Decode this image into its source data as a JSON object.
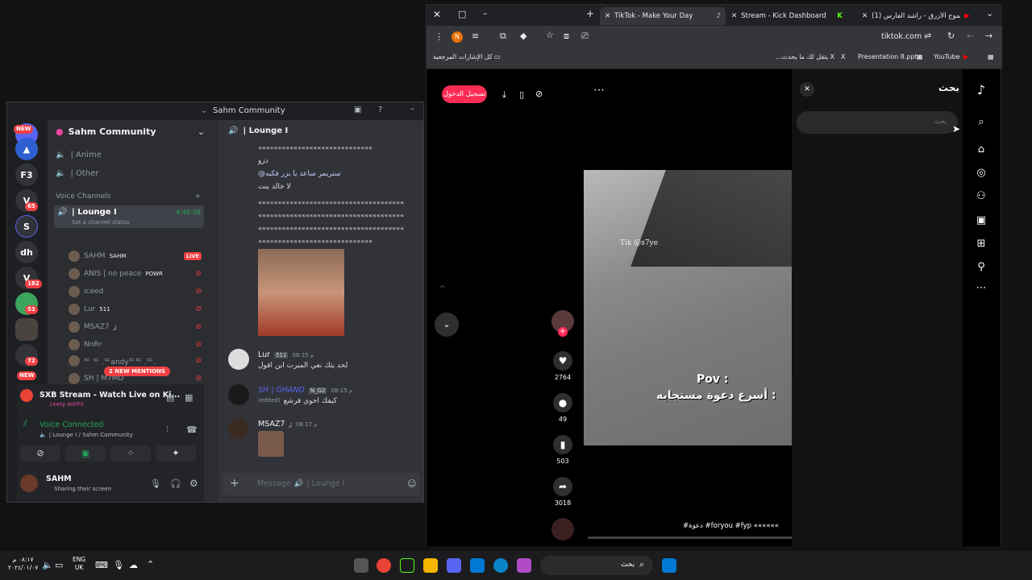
{
  "discord": {
    "window_title": "Sahm Community",
    "server_name": "Sahm Community",
    "guild_badges": [
      "NEW",
      "65",
      "182",
      "53",
      "72",
      "NEW"
    ],
    "guild_label": "dh",
    "text_channels": [
      "| Anime",
      "| Other"
    ],
    "voice_header": "Voice Channels",
    "active_voice": "| Lounge I",
    "active_timer": "4:46:08",
    "channel_status": "Set a channel status",
    "voice_users": [
      {
        "name": "SAHM",
        "tag": "SAHM",
        "badge": "LIVE"
      },
      {
        "name": "ANIS | no peace",
        "tag": "POWR"
      },
      {
        "name": "iceed",
        "tag": ""
      },
      {
        "name": "Lur",
        "tag": "511"
      },
      {
        "name": "MSAZ7",
        "tag": "ژ"
      },
      {
        "name": "NnRr",
        "tag": ""
      },
      {
        "name": "ᄃ ᄃ .ᄃandyᄃᄃ .ᄃ.",
        "tag": ""
      },
      {
        "name": "SH | M7MD",
        "tag": ""
      },
      {
        "name": "SH",
        "tag": ""
      }
    ],
    "mentions_pill": "2 NEW MENTIONS",
    "activity_title": "SXB Stream - Watch Live on Ki...",
    "activity_sub": "1440p 60FPS",
    "voice_connected": "Voice Connected",
    "voice_location": "| Lounge I / Sahm Community",
    "user_name": "SAHM",
    "user_status": "Sharing their screen",
    "chat_header": "| Lounge I",
    "chat_lines": [
      "«««««««««««««««««««««««««««««",
      "دزو",
      "@ستريمر ساعد يا بزر فكيه",
      "لا خالد بنت",
      "«««««««««««««««««««««««««««««««««««««",
      "«««««««««««««««««««««««««««««««««««««",
      "«««««««««««««««««««««««««««««««««««««",
      "«««««««««««««««««««««««««««««"
    ],
    "messages": [
      {
        "author": "Lur",
        "tag": "511",
        "time": "08:15 م",
        "text": "لحد يتك نعي الميرت اين اقول"
      },
      {
        "author": "SH | GHAND",
        "tag": "N_G2",
        "time": "08:15 م",
        "text": "كيفك اخوي قرشع",
        "edited": "(edited)"
      },
      {
        "author": "MSAZ7",
        "tag": "ژ",
        "time": "08:17 م",
        "text": ""
      }
    ],
    "composer_placeholder": "Message",
    "composer_channel": "| Lounge I"
  },
  "browser": {
    "tabs": [
      {
        "title": "TikTok - Make Your Day"
      },
      {
        "title": "Stream - Kick Dashboard"
      },
      {
        "title": "(1) الموج الأزرق - راشد الفارس"
      }
    ],
    "url": "tiktok.com",
    "bookmarks": [
      "كل الإشارات المرجعية",
      "...يتقل لك ما يحدث X",
      "Presentation 8.pptx",
      "YouTube"
    ],
    "profile_initial": "N"
  },
  "tiktok": {
    "login_label": "تسجيل الدخول",
    "search_title": "بحث",
    "search_placeholder": "بحث",
    "video_watermark": "Tik @s7ye",
    "video_caption_1": "Pov :",
    "video_caption_2": "أسرع دعوة مستجابه :",
    "likes": "2764",
    "comments": "49",
    "saves": "503",
    "shares": "3018",
    "hashtags": "#دعوة #foryou #fyp ««««««"
  },
  "taskbar": {
    "time": "٠٨:١٧ م",
    "date": "٢٠٢٤/٠١/٠٧",
    "lang": "ENG",
    "region": "UK",
    "search_label": "بحث"
  }
}
